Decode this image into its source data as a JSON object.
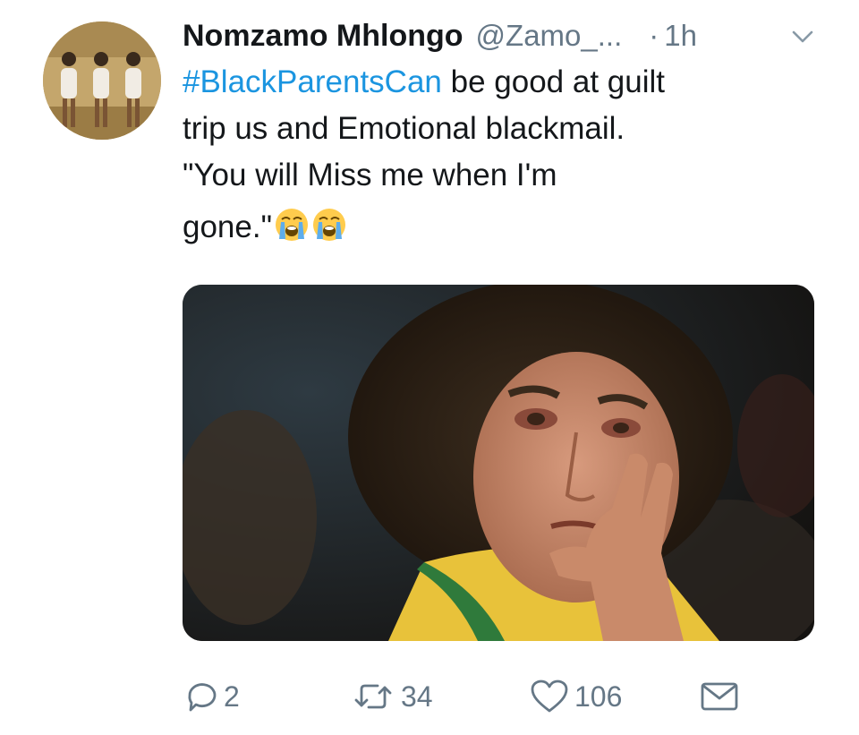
{
  "tweet": {
    "author_name": "Nomzamo Mhlongo",
    "author_handle": "@Zamo_...",
    "time_separator": "·",
    "time": "1h",
    "hashtag": "#BlackParentsCan",
    "text_line1_rest": " be good at guilt",
    "text_line2": "trip us and Emotional blackmail.",
    "text_line3": "\"You will Miss me when I'm",
    "text_line4": "gone.\"",
    "emojis": [
      "loudly-crying-face-icon",
      "loudly-crying-face-icon"
    ],
    "hashtag_color": "#1b95e0"
  },
  "actions": {
    "reply_count": "2",
    "retweet_count": "34",
    "like_count": "106"
  },
  "icons": {
    "caret": "chevron-down-icon",
    "reply": "reply-bubble-icon",
    "retweet": "retweet-icon",
    "like": "heart-icon",
    "dm": "envelope-icon"
  },
  "colors": {
    "text": "#14171a",
    "secondary": "#657786",
    "link": "#1b95e0"
  }
}
